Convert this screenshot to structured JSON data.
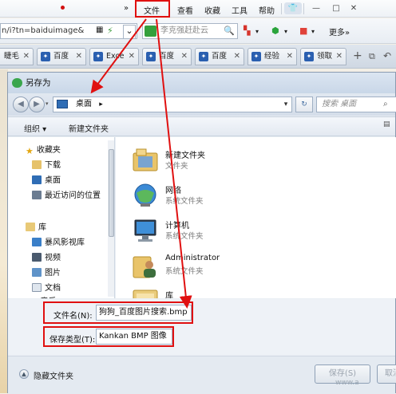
{
  "browser": {
    "menu": {
      "file": "文件",
      "view": "查看",
      "favorites": "收藏",
      "tools": "工具",
      "help": "帮助",
      "overflow": "»"
    },
    "window_controls": {
      "minimize": "—",
      "maximize": "□",
      "close": "✕"
    },
    "address": {
      "url_fragment": "n/i?tn=baiduimage&",
      "search_placeholder": "李克强赶赴云",
      "more_label": "更多»"
    },
    "tabs": [
      {
        "label": "睫毛"
      },
      {
        "label": "百度"
      },
      {
        "label": "Exce"
      },
      {
        "label": "百度"
      },
      {
        "label": "百度"
      },
      {
        "label": "经验"
      },
      {
        "label": "领取"
      }
    ],
    "new_tab": "+"
  },
  "dialog": {
    "title": "另存为",
    "breadcrumb": {
      "location": "桌面",
      "chevron": "▸"
    },
    "search_placeholder": "搜索 桌面",
    "toolbar": {
      "organize": "组织 ▾",
      "new_folder": "新建文件夹"
    },
    "nav": {
      "favorites_header": "收藏夹",
      "favorites": [
        "下载",
        "桌面",
        "最近访问的位置"
      ],
      "library_header": "库",
      "library": [
        "暴风影视库",
        "视频",
        "图片",
        "文档",
        "音乐"
      ]
    },
    "files": [
      {
        "name": "新建文件夹",
        "type": "文件夹",
        "icon": "folder-icon"
      },
      {
        "name": "网络",
        "type": "系统文件夹",
        "icon": "network-icon"
      },
      {
        "name": "计算机",
        "type": "系统文件夹",
        "icon": "computer-icon"
      },
      {
        "name": "Administrator",
        "type": "系统文件夹",
        "icon": "user-folder-icon"
      },
      {
        "name": "库",
        "type": "",
        "icon": "library-icon"
      }
    ],
    "form": {
      "filename_label": "文件名(N):",
      "filename_value": "狗狗_百度图片搜索.bmp",
      "filetype_label": "保存类型(T):",
      "filetype_value": "Kankan BMP 图像"
    },
    "footer": {
      "hide_folders": "隐藏文件夹",
      "save": "保存(S)",
      "cancel": "取消"
    }
  },
  "watermark": "www.a",
  "colors": {
    "highlight_red": "#e01010",
    "accent_blue": "#2a5fb0"
  }
}
